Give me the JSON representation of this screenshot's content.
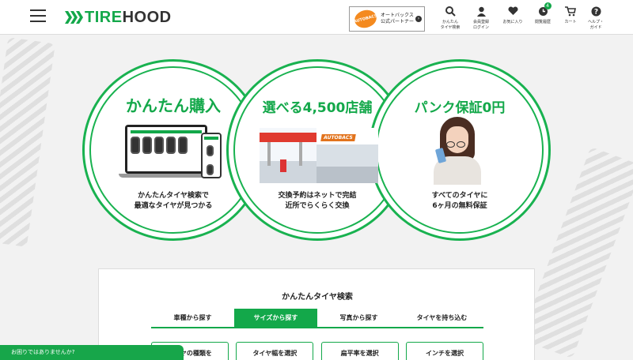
{
  "header": {
    "logo_prefix": "TIRE",
    "logo_suffix": "HOOD",
    "partner": {
      "line1": "オートバックス",
      "line2": "公式パートナー",
      "logo_text": "AUTOBACS"
    },
    "nav": [
      {
        "label": "かんたん\nタイヤ検索",
        "icon": "search-icon"
      },
      {
        "label": "会員登録\nログイン",
        "icon": "user-icon"
      },
      {
        "label": "お気に入り",
        "icon": "heart-icon"
      },
      {
        "label": "閲覧履歴",
        "icon": "history-icon",
        "badge": "4"
      },
      {
        "label": "カート",
        "icon": "cart-icon"
      },
      {
        "label": "ヘルプ・\nガイド",
        "icon": "help-icon"
      }
    ]
  },
  "hero": [
    {
      "title": "かんたん購入",
      "desc": "かんたんタイヤ検索で\n最適なタイヤが見つかる"
    },
    {
      "title": "選べる4,500店舗",
      "desc": "交換予約はネットで完結\n近所でらくらく交換",
      "store_sign": "AUTOBACS"
    },
    {
      "title": "パンク保証0円",
      "desc": "すべてのタイヤに\n6ヶ月の無料保証"
    }
  ],
  "search": {
    "title": "かんたんタイヤ検索",
    "tabs": [
      "車種から探す",
      "サイズから探す",
      "写真から探す",
      "タイヤを持ち込む"
    ],
    "active_tab": 1,
    "buttons": [
      "タイヤの種類を",
      "タイヤ幅を選択",
      "扁平率を選択",
      "インチを選択"
    ]
  },
  "help_bar": "お困りではありませんか?",
  "colors": {
    "brand": "#13a84a"
  }
}
